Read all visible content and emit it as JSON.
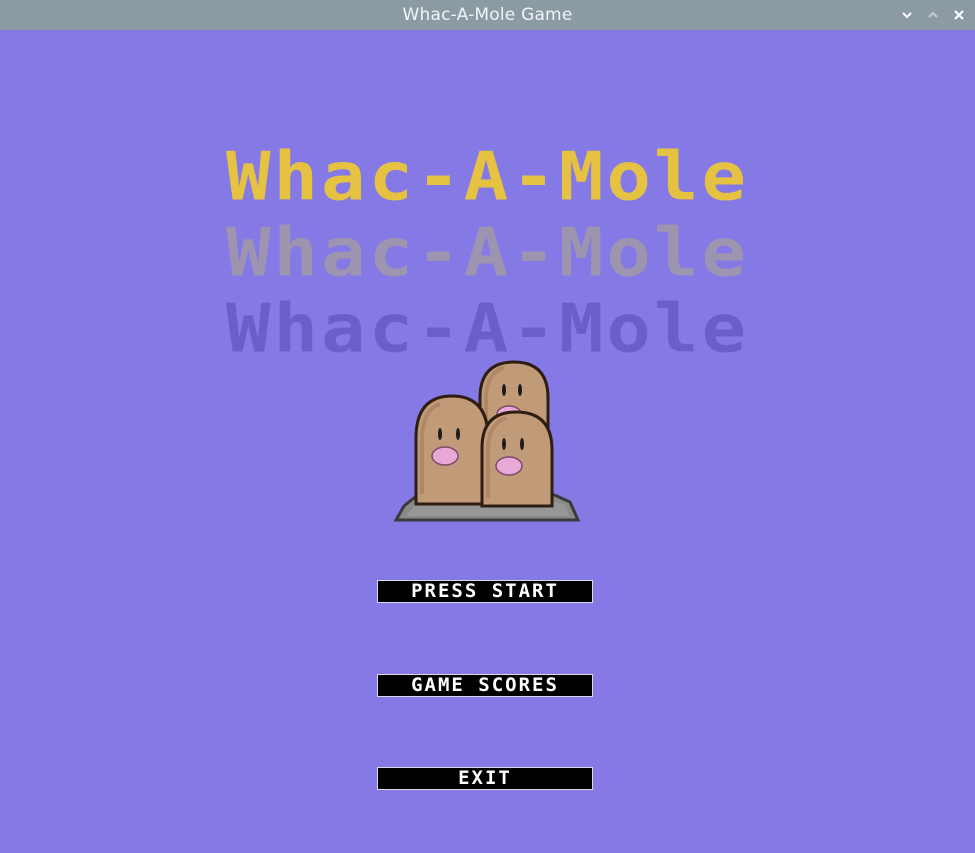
{
  "window": {
    "title": "Whac-A-Mole Game"
  },
  "game": {
    "title": "Whac-A-Mole",
    "title_color": "#e6c243",
    "shadow_colors": [
      "#9d94b0",
      "#6a5fca"
    ],
    "background": "#8579e6"
  },
  "menu": {
    "start_label": "PRESS START",
    "scores_label": "GAME SCORES",
    "exit_label": "EXIT"
  },
  "icons": {
    "minimize": "chevron-down-icon",
    "maximize": "chevron-up-icon",
    "close": "close-icon"
  }
}
